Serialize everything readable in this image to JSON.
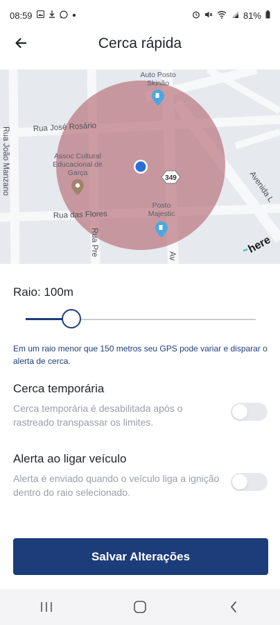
{
  "status_bar": {
    "time": "08:59",
    "battery": "81%",
    "notification_icons": [
      "gallery-icon",
      "download-icon",
      "whatsapp-icon",
      "dot-icon"
    ],
    "system_icons": [
      "alarm-icon",
      "mute-icon",
      "wifi-icon",
      "signal-icon",
      "battery-icon"
    ]
  },
  "header": {
    "title": "Cerca rápida",
    "back_icon": "arrow-left-icon"
  },
  "map": {
    "streets": {
      "rua_jose_rosario": "Rua José Rosário",
      "rua_das_flores": "Rua das Flores",
      "rua_joao_manzano": "Rua João Manzano",
      "rua_pre": "Rua Pre",
      "avenida": "Avenida L",
      "av_short": "Av"
    },
    "pois": {
      "auto_posto_line1": "Auto Posto",
      "auto_posto_line2": "Skinão",
      "assoc_line1": "Assoc Cultural",
      "assoc_line2": "Educacional de",
      "assoc_line3": "Garça",
      "posto_line1": "Posto",
      "posto_line2": "Majestic"
    },
    "route_shield": "349",
    "brand": "here",
    "geofence_color": "#b3646e"
  },
  "radius": {
    "label": "Raio: 100m",
    "value_fraction": 0.2
  },
  "gps_note": "Em um raio menor que 150 metros seu GPS pode variar e disparar o alerta de cerca.",
  "settings": [
    {
      "title": "Cerca temporária",
      "description": "Cerca temporária é desabilitada após o rastreado transpassar os limites.",
      "enabled": false
    },
    {
      "title": "Alerta ao ligar veículo",
      "description": "Alerta é enviado quando o veículo liga a ignição dentro do raio selecionado.",
      "enabled": false
    }
  ],
  "save_button_label": "Salvar Alterações",
  "colors": {
    "primary": "#1d3d7a",
    "map_background": "#e6e9ee",
    "toggle_off": "#e7e8ec"
  },
  "nav_bar": [
    "recent-apps-icon",
    "home-icon",
    "back-nav-icon"
  ]
}
